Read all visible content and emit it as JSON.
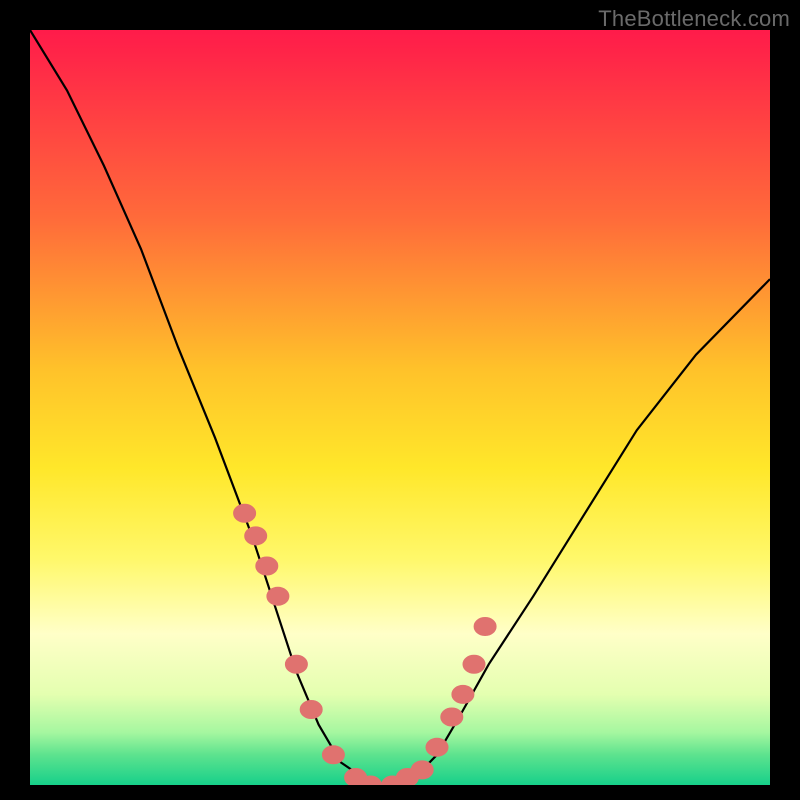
{
  "watermark": "TheBottleneck.com",
  "colors": {
    "bg": "#000000",
    "marker": "#e0726f",
    "gradient_stops": [
      {
        "t": 0.0,
        "color": "#ff1b4a"
      },
      {
        "t": 0.25,
        "color": "#ff6b3a"
      },
      {
        "t": 0.45,
        "color": "#ffc22a"
      },
      {
        "t": 0.58,
        "color": "#ffe72a"
      },
      {
        "t": 0.7,
        "color": "#fff86a"
      },
      {
        "t": 0.8,
        "color": "#ffffc8"
      },
      {
        "t": 0.88,
        "color": "#e4ffb0"
      },
      {
        "t": 0.93,
        "color": "#a6f7a0"
      },
      {
        "t": 0.96,
        "color": "#5de38e"
      },
      {
        "t": 1.0,
        "color": "#17d08a"
      }
    ]
  },
  "chart_data": {
    "type": "line",
    "title": "",
    "xlabel": "",
    "ylabel": "",
    "xlim": [
      0,
      100
    ],
    "ylim": [
      0,
      100
    ],
    "series": [
      {
        "name": "bottleneck-curve",
        "x": [
          0,
          5,
          10,
          15,
          20,
          25,
          30,
          33,
          36,
          39,
          42,
          45,
          48,
          52,
          55,
          58,
          62,
          68,
          75,
          82,
          90,
          100
        ],
        "values": [
          100,
          92,
          82,
          71,
          58,
          46,
          33,
          24,
          15,
          8,
          3,
          1,
          0,
          1,
          4,
          9,
          16,
          25,
          36,
          47,
          57,
          67
        ]
      }
    ],
    "markers": {
      "name": "highlight-dots",
      "x": [
        29,
        30.5,
        32,
        33.5,
        36,
        38,
        41,
        44,
        46,
        49,
        51,
        53,
        55,
        57,
        58.5,
        60,
        61.5
      ],
      "values": [
        36,
        33,
        29,
        25,
        16,
        10,
        4,
        1,
        0,
        0,
        1,
        2,
        5,
        9,
        12,
        16,
        21
      ]
    },
    "gradient_description": "vertical heat gradient red→yellow→green indicating bottleneck severity (top=bad, bottom=good)"
  }
}
